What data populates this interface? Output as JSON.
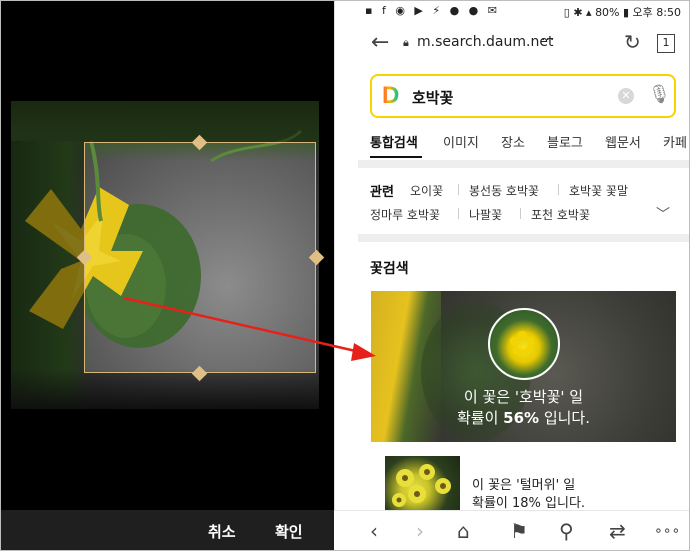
{
  "crop_editor": {
    "cancel_label": "취소",
    "confirm_label": "확인"
  },
  "status_bar": {
    "left_icons": "▪ f ◉ ▶ ⚡ ● ● ✉",
    "right_text": "▯ ✱ ▴ 80% ▮ 오후 8:50"
  },
  "browser": {
    "url": "m.search.daum.net",
    "url_more": "···",
    "tab_count": "1",
    "icons": {
      "back": "back-arrow-icon",
      "lock": "lock-icon",
      "reload": "reload-icon",
      "tabs": "tabs-icon"
    }
  },
  "search": {
    "logo": "D",
    "query": "호박꽃",
    "clear_icon": "clear-icon",
    "mic_icon": "microphone-icon"
  },
  "tabs": [
    "통합검색",
    "이미지",
    "장소",
    "블로그",
    "웹문서",
    "카페"
  ],
  "related": {
    "label": "관련",
    "items": [
      "오이꽃",
      "봉선동 호박꽃",
      "호박꽃 꽃말",
      "정마루 호박꽃",
      "나팔꽃",
      "포천 호박꽃"
    ]
  },
  "flower_search": {
    "title": "꽃검색",
    "top_result": {
      "line1": "이 꽃은 '호박꽃' 일",
      "line2_prefix": "확률이 ",
      "probability": "56%",
      "line2_suffix": " 입니다."
    },
    "second_result": {
      "line1": "이 꽃은 '털머위' 일",
      "line2": "확률이 18% 입니다."
    }
  },
  "bottom_nav": {
    "back": "‹",
    "forward": "›",
    "home": "⌂",
    "bookmark": "⚑",
    "search": "⚲",
    "share": "⇄",
    "more": "∘∘∘"
  },
  "colors": {
    "search_border": "#f7d300",
    "arrow": "#e8201a",
    "crop_border": "#d9b77a"
  }
}
